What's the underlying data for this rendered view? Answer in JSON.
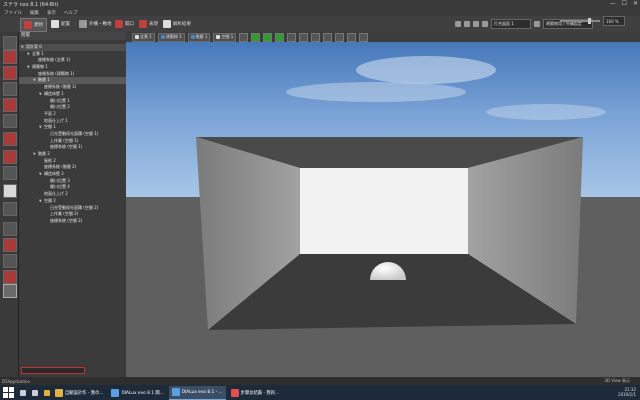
{
  "window": {
    "title": "ステラ nxx 8.1 (64-Bit)",
    "controls": [
      "—",
      "☐",
      "✕"
    ]
  },
  "menu": [
    "ファイル",
    "編集",
    "表示",
    "ヘルプ"
  ],
  "ribbon": {
    "tabs": [
      {
        "label": "建物",
        "icon": "building-icon"
      },
      {
        "label": "配置",
        "icon": "place-icon"
      },
      {
        "label": "外構・敷地",
        "icon": "site-icon"
      },
      {
        "label": "開口",
        "icon": "opening-icon"
      },
      {
        "label": "表現",
        "icon": "render-icon"
      },
      {
        "label": "解析結果",
        "icon": "result-icon"
      }
    ],
    "right_dropdown_1": "打合図面 1",
    "right_dropdown_2": "建築物用 / 外構設定",
    "zoom_value": "100 %"
  },
  "panel": {
    "title": "階層",
    "tree": [
      {
        "label": "設計案 0",
        "level": 0,
        "arrow": "▼",
        "style": "hdr"
      },
      {
        "label": "全景 1",
        "level": 1,
        "arrow": "▼"
      },
      {
        "label": "座標系統 (全景 1)",
        "level": 2,
        "arrow": ""
      },
      {
        "label": "建築物 1",
        "level": 1,
        "arrow": "▼"
      },
      {
        "label": "座標系統 (建築物 1)",
        "level": 2,
        "arrow": ""
      },
      {
        "label": "階層 1",
        "level": 2,
        "arrow": "▼",
        "style": "sel"
      },
      {
        "label": "座標系統 (階層 1)",
        "level": 3,
        "arrow": ""
      },
      {
        "label": "構造体壁 1",
        "level": 3,
        "arrow": "▼"
      },
      {
        "label": "開口位置 1",
        "level": 4,
        "arrow": ""
      },
      {
        "label": "開口位置 2",
        "level": 4,
        "arrow": ""
      },
      {
        "label": "平面 2",
        "level": 3,
        "arrow": ""
      },
      {
        "label": "地面仕上げ 1",
        "level": 3,
        "arrow": ""
      },
      {
        "label": "空間 1",
        "level": 3,
        "arrow": "▼"
      },
      {
        "label": "日光受動採光面積 (空間 1)",
        "level": 4,
        "arrow": ""
      },
      {
        "label": "上作業 (空間 1)",
        "level": 4,
        "arrow": ""
      },
      {
        "label": "座標系統 (空間 1)",
        "level": 4,
        "arrow": ""
      },
      {
        "label": "階層 2",
        "level": 2,
        "arrow": "▼"
      },
      {
        "label": "屋根 2",
        "level": 3,
        "arrow": ""
      },
      {
        "label": "座標系統 (階層 2)",
        "level": 3,
        "arrow": ""
      },
      {
        "label": "構造体壁 2",
        "level": 3,
        "arrow": "▼"
      },
      {
        "label": "開口位置 3",
        "level": 4,
        "arrow": ""
      },
      {
        "label": "開口位置 4",
        "level": 4,
        "arrow": ""
      },
      {
        "label": "地面仕上げ 2",
        "level": 3,
        "arrow": ""
      },
      {
        "label": "空間 2",
        "level": 3,
        "arrow": "▼"
      },
      {
        "label": "日光受動採光面積 (空間 2)",
        "level": 4,
        "arrow": ""
      },
      {
        "label": "上作業 (空間 2)",
        "level": 4,
        "arrow": ""
      },
      {
        "label": "座標系統 (空間 2)",
        "level": 4,
        "arrow": ""
      }
    ]
  },
  "viewport_toolbar": {
    "items": [
      "全景 1",
      "建築物 1",
      "階層 1",
      "空間 1"
    ]
  },
  "status": {
    "left": "DSApplication",
    "right": "3D View 表示"
  },
  "taskbar": {
    "items": [
      {
        "label": "自動設計作 - 我の...",
        "color": "#e0b040",
        "active": false
      },
      {
        "label": "DIALux evo 8.1 関...",
        "color": "#5aa0e0",
        "active": false
      },
      {
        "label": "DIALux evo 8.1 - ...",
        "color": "#5aa0e0",
        "active": true
      },
      {
        "label": "步骤总结篇 - 我的...",
        "color": "#e05050",
        "active": false
      }
    ],
    "time": "21:32",
    "date": "2019/2/1"
  },
  "colors": {
    "sky_top": "#3f72b5",
    "sky_bottom": "#9cc0e4",
    "floor": "#3a3a3a",
    "wall": "#8e8e8e",
    "back_opening": "#f2f2f2"
  }
}
